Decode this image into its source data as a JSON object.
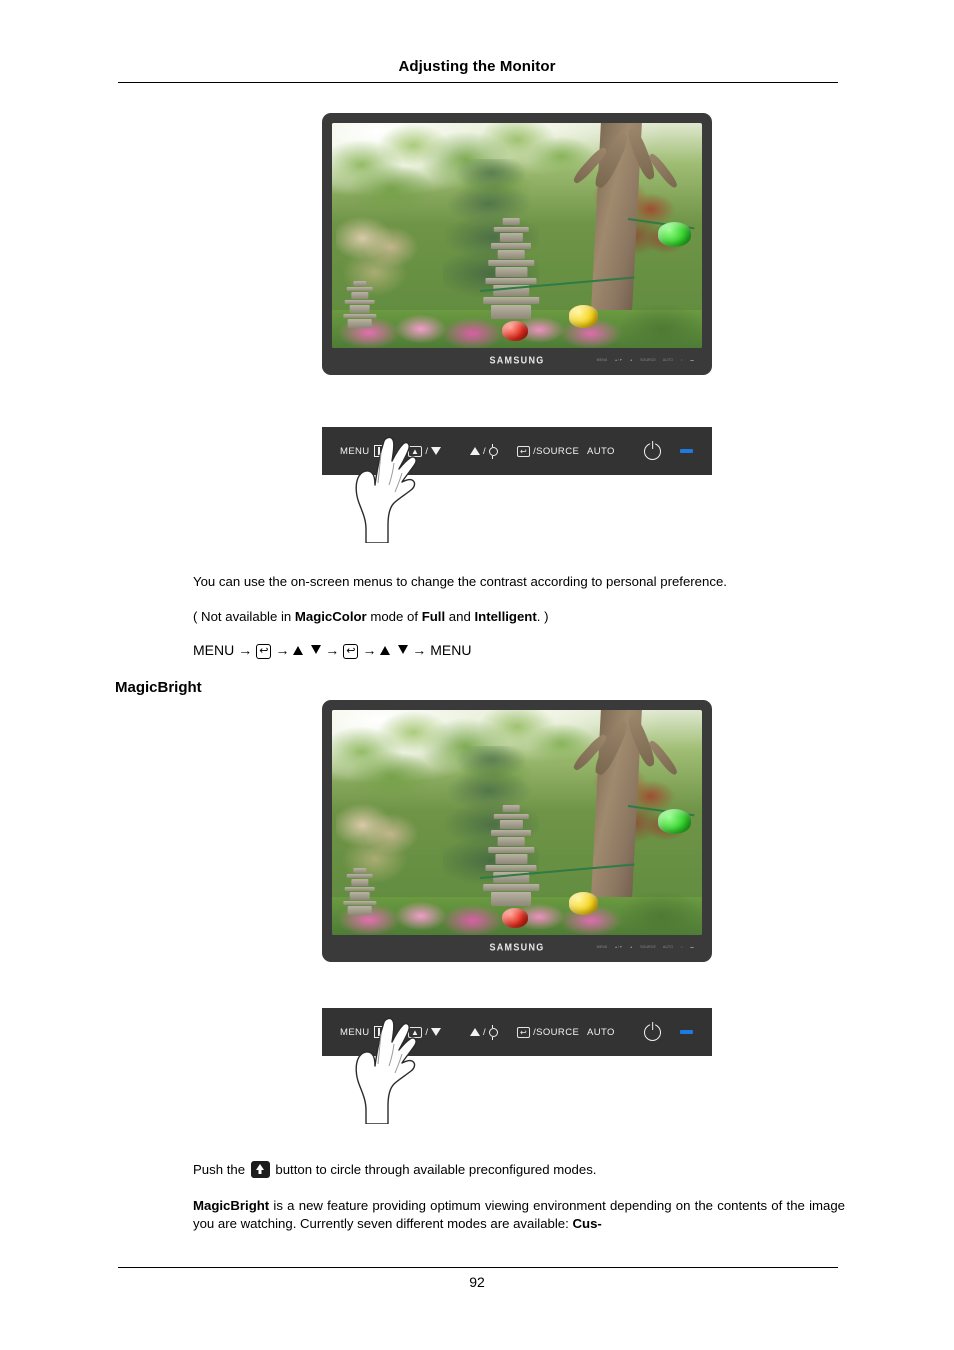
{
  "header": {
    "title": "Adjusting the Monitor"
  },
  "footer": {
    "page_number": "92"
  },
  "monitor": {
    "brand": "SAMSUNG",
    "bezel_keys": [
      "MENU",
      "▲/▼",
      "▲",
      "SOURCE",
      "AUTO",
      "☼",
      "▬"
    ],
    "screen_description": "Photograph of a Korean garden with a multi-tier stone pagoda, green pine and deciduous trees, pink flower bed, and hanging paper lanterns in green, yellow and red"
  },
  "control_panel": {
    "buttons": [
      {
        "name": "menu",
        "label": "MENU",
        "icon": "menu-bars-icon"
      },
      {
        "name": "down",
        "label": "/",
        "icon": "boxed-up-arrow-icon",
        "icon2": "triangle-down-icon"
      },
      {
        "name": "up",
        "label": "/",
        "icon": "triangle-up-icon",
        "icon2": "brightness-sun-icon"
      },
      {
        "name": "source",
        "label": "/SOURCE",
        "icon": "boxed-enter-icon"
      },
      {
        "name": "auto",
        "label": "AUTO",
        "icon": ""
      },
      {
        "name": "power",
        "label": "",
        "icon": "power-icon"
      },
      {
        "name": "led",
        "label": "",
        "icon": "power-led-indicator"
      }
    ],
    "led_color": "#1f7ae0",
    "panel_color": "#333333"
  },
  "content": {
    "intro": "You can use the on-screen menus to change the contrast according to personal preference.",
    "note_prefix": "( Not available in ",
    "note_magiccolor": "MagicColor",
    "note_mid": " mode of ",
    "note_full": "Full",
    "note_and": " and ",
    "note_intelligent": "Intelligent",
    "note_suffix": ". )",
    "nav_start": "MENU",
    "nav_end": "MENU",
    "section_title": "MagicBright",
    "push_prefix": "Push the ",
    "push_suffix": " button to circle through available preconfigured modes.",
    "desc_bold": "MagicBright",
    "desc_body": " is a new feature providing optimum viewing environment depending on the contents of the image you are watching. Currently seven different modes are available: ",
    "desc_trailing_bold": "Cus-"
  }
}
